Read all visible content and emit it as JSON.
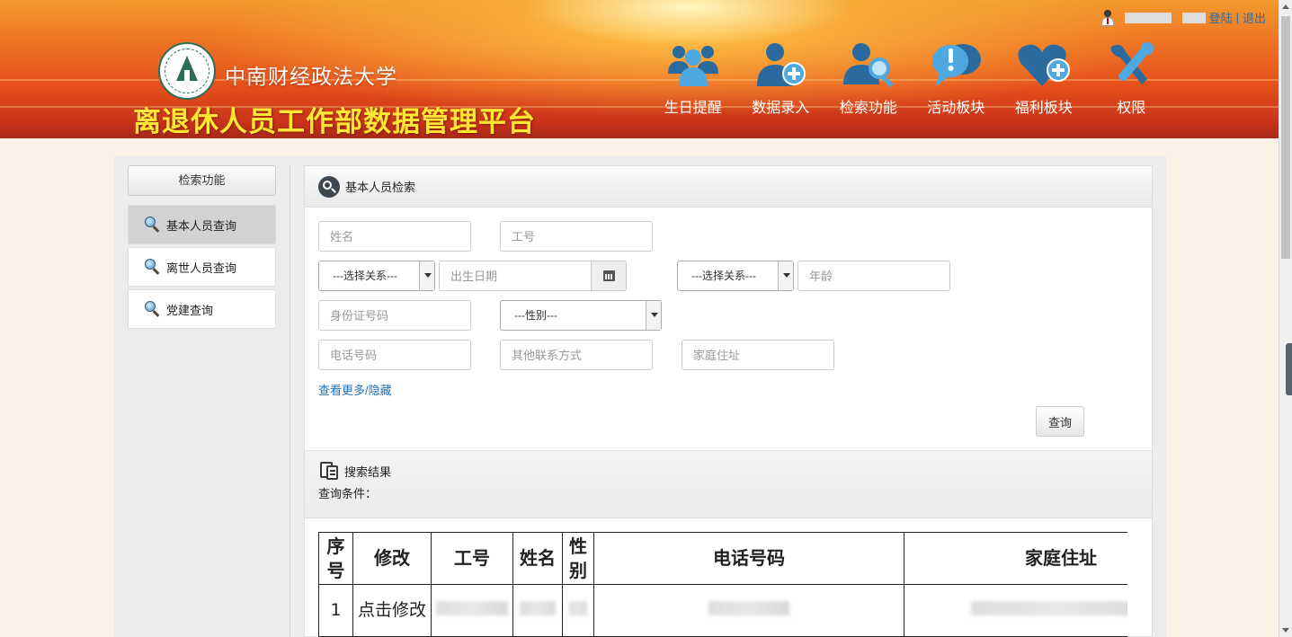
{
  "header": {
    "university_name": "中南财经政法大学",
    "platform_title": "离退休人员工作部数据管理平台",
    "user": {
      "login_label": "登陆",
      "separator": "|",
      "logout_label": "退出"
    },
    "nav": [
      {
        "label": "生日提醒",
        "icon": "birthday-group-icon"
      },
      {
        "label": "数据录入",
        "icon": "add-user-icon"
      },
      {
        "label": "检索功能",
        "icon": "search-user-icon"
      },
      {
        "label": "活动板块",
        "icon": "chat-bubbles-icon"
      },
      {
        "label": "福利板块",
        "icon": "heart-plus-icon"
      },
      {
        "label": "权限",
        "icon": "tools-icon"
      }
    ]
  },
  "sidebar": {
    "title": "检索功能",
    "items": [
      {
        "label": "基本人员查询",
        "active": true
      },
      {
        "label": "离世人员查询",
        "active": false
      },
      {
        "label": "党建查询",
        "active": false
      }
    ]
  },
  "panel": {
    "title": "基本人员检索",
    "form": {
      "name_placeholder": "姓名",
      "staff_id_placeholder": "工号",
      "relation_select_1": "---选择关系---",
      "birth_date_placeholder": "出生日期",
      "relation_select_2": "---选择关系---",
      "age_placeholder": "年龄",
      "id_card_placeholder": "身份证号码",
      "gender_select": "---性别---",
      "phone_placeholder": "电话号码",
      "other_contact_placeholder": "其他联系方式",
      "address_placeholder": "家庭住址",
      "more_link": "查看更多/隐藏",
      "query_button": "查询"
    },
    "results": {
      "title": "搜索结果",
      "condition_label": "查询条件：",
      "columns": [
        "序号",
        "修改",
        "工号",
        "姓名",
        "性别",
        "电话号码",
        "家庭住址"
      ],
      "rows": [
        {
          "index": "1",
          "edit_link": "点击修改"
        }
      ]
    }
  },
  "colors": {
    "title_yellow": "#ffe733",
    "link_blue": "#1d6fb8",
    "nav_icon_blue": "#2b6a9e"
  }
}
